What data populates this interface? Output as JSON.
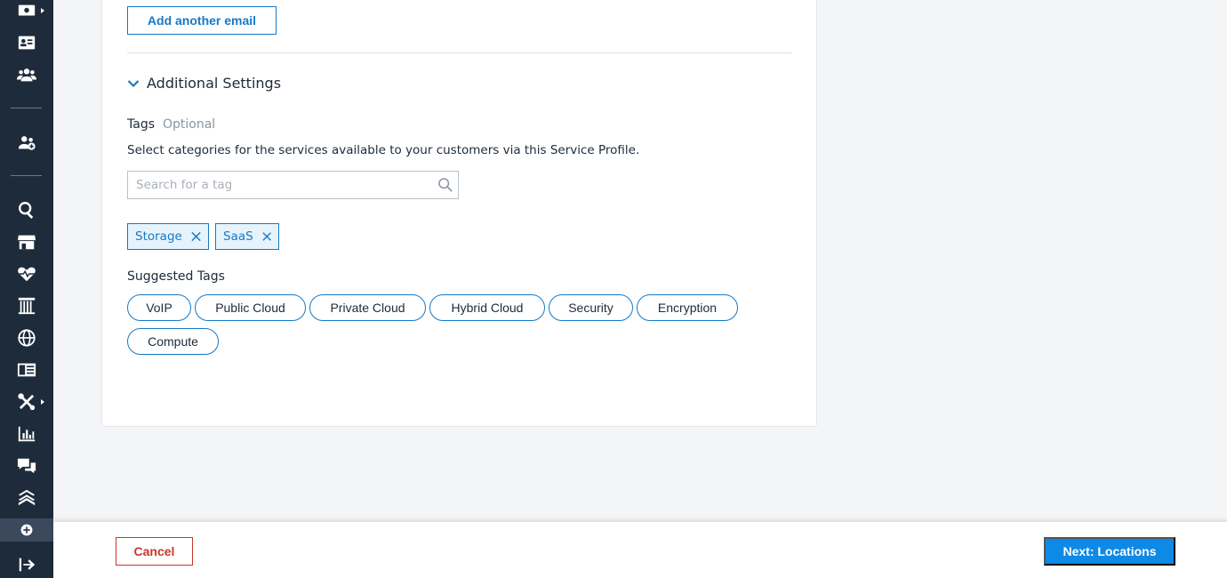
{
  "sidebar": {
    "icons": [
      "billing-icon",
      "contact-card-icon",
      "users-icon",
      "customers-icon",
      "search-icon",
      "storefront-icon",
      "health-icon",
      "columns-icon",
      "globe-icon",
      "catalog-icon",
      "tools-icon",
      "reports-icon",
      "chat-icon",
      "layers-icon",
      "add-circle-icon",
      "logout-icon"
    ]
  },
  "form": {
    "add_email_label": "Add another email",
    "additional_settings_title": "Additional Settings",
    "tags_label": "Tags",
    "tags_optional": "Optional",
    "tags_description": "Select categories for the services available to your customers via this Service Profile.",
    "search_placeholder": "Search for a tag",
    "selected_tags": [
      "Storage",
      "SaaS"
    ],
    "suggested_label": "Suggested Tags",
    "suggested_tags": [
      "VoIP",
      "Public Cloud",
      "Private Cloud",
      "Hybrid Cloud",
      "Security",
      "Encryption",
      "Compute"
    ]
  },
  "footer": {
    "cancel_label": "Cancel",
    "next_label": "Next: Locations"
  },
  "colors": {
    "sidebar_bg": "#1d2b3a",
    "accent_blue": "#1579c7",
    "primary_button": "#0d8ae6",
    "cancel_red": "#c8362b",
    "chip_bg": "#e6f3fb"
  }
}
